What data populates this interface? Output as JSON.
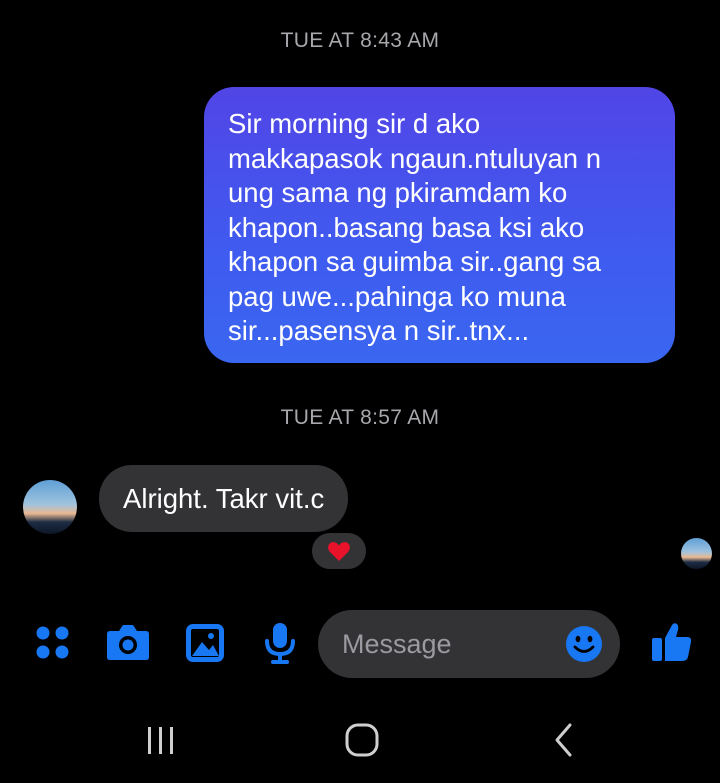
{
  "thread": {
    "timestamp_1": "TUE AT 8:43 AM",
    "timestamp_2": "TUE AT 8:57 AM",
    "sent_message": "Sir morning sir d ako\nmakkapasok ngaun.ntuluyan n\nung sama ng pkiramdam ko\nkhapon..basang basa ksi ako\nkhapon sa guimba sir..gang sa\npag uwe...pahinga ko muna\nsir...pasensya n sir..tnx...",
    "received_message": "Alright. Takr vit.c",
    "reaction": "heart"
  },
  "composer": {
    "placeholder": "Message",
    "icons": [
      "apps-icon",
      "camera-icon",
      "gallery-icon",
      "microphone-icon",
      "emoji-icon",
      "thumbs-up-icon"
    ]
  },
  "nav_bar": {
    "icons": [
      "recent-apps-icon",
      "home-icon",
      "back-icon"
    ]
  },
  "colors": {
    "background": "#000000",
    "accent": "#1877f2",
    "sent_bubble_top": "#5145e6",
    "sent_bubble_bottom": "#3a66f0",
    "received_bubble": "#333336",
    "timestamp": "#a7a7ac",
    "reaction_heart": "#e8132b"
  }
}
